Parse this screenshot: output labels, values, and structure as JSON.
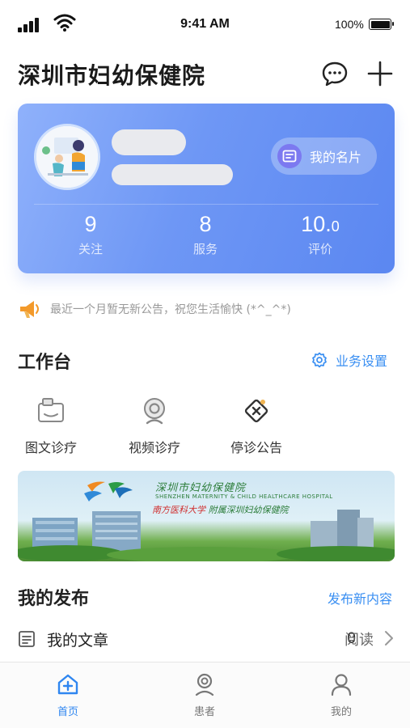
{
  "status": {
    "time": "9:41 AM",
    "battery": "100%"
  },
  "header": {
    "title": "深圳市妇幼保健院"
  },
  "card": {
    "button_label": "我的名片",
    "stats": [
      {
        "value": "9",
        "label": "关注"
      },
      {
        "value": "8",
        "label": "服务"
      },
      {
        "value": "10.",
        "value_small": "0",
        "label": "评价"
      }
    ]
  },
  "notice": {
    "text": "最近一个月暂无新公告，祝您生活愉快 (*^_^*)"
  },
  "workbench": {
    "title": "工作台",
    "settings_label": "业务设置",
    "tools": [
      {
        "label": "图文诊疗",
        "icon": "chat-doc-icon"
      },
      {
        "label": "视频诊疗",
        "icon": "camera-icon"
      },
      {
        "label": "停诊公告",
        "icon": "stop-notice-icon"
      }
    ]
  },
  "banner": {
    "title": "深圳市妇幼保健院",
    "subtitle": "SHENZHEN MATERNITY & CHILD HEALTHCARE HOSPITAL",
    "subtitle2_red": "南方医科大学",
    "subtitle2_green": "附属深圳妇幼保健院"
  },
  "publish": {
    "title": "我的发布",
    "new_label": "发布新内容",
    "article_label": "我的文章",
    "article_count": "0",
    "article_unit": "阅读"
  },
  "tabbar": {
    "tabs": [
      {
        "label": "首页",
        "active": true
      },
      {
        "label": "患者",
        "active": false
      },
      {
        "label": "我的",
        "active": false
      }
    ]
  },
  "colors": {
    "accent": "#3a8ff2",
    "card_start": "#8fb1fb",
    "card_end": "#5b87f1"
  }
}
